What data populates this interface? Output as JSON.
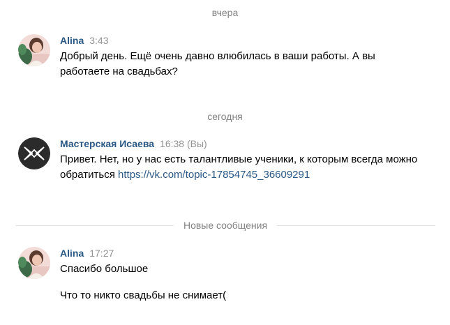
{
  "separators": {
    "yesterday": "вчера",
    "today": "сегодня",
    "new_messages": "Новые сообщения"
  },
  "messages": [
    {
      "author": "Alina",
      "time": "3:43",
      "text": "Добрый день. Ещё очень давно влюбилась в ваши работы. А вы работаете на свадьбах?",
      "avatar_icon": "user-avatar-photo"
    },
    {
      "author": "Мастерская Исаева",
      "time": "16:38 (Вы)",
      "text": "Привет. Нет, но у нас есть талантливые ученики, к которым всегда можно обратиться ",
      "link": "https://vk.com/topic-17854745_36609291",
      "avatar_icon": "studio-logo-icon"
    },
    {
      "author": "Alina",
      "time": "17:27",
      "lines": [
        "Спасибо большое",
        "Что то никто свадьбы не снимает("
      ],
      "avatar_icon": "user-avatar-photo"
    }
  ],
  "colors": {
    "author": "#2a5885",
    "link": "#2a5885",
    "muted": "#828282",
    "logo_bg": "#2b2b2b"
  }
}
